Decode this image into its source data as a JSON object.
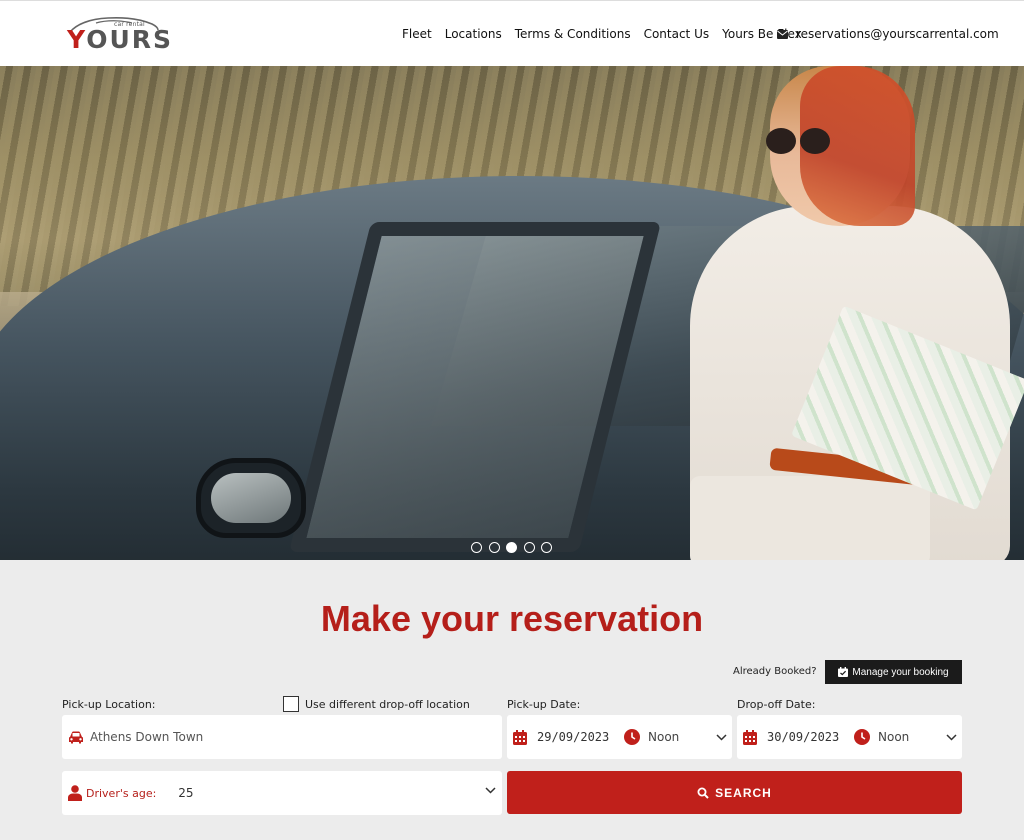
{
  "brand": {
    "logo_tagline": "car rental",
    "logo_letter": "Y",
    "logo_rest": "OURS"
  },
  "nav": {
    "items": [
      "Fleet",
      "Locations",
      "Terms & Conditions",
      "Contact Us",
      "Yours Be Flex"
    ],
    "email": "reservations@yourscarrental.com"
  },
  "hero": {
    "slide_count": 5,
    "active_slide": 3
  },
  "reservation": {
    "title": "Make your reservation",
    "already_booked": "Already Booked?",
    "manage_label": "Manage your booking",
    "pickup_location_label": "Pick-up Location:",
    "different_dropoff_label": "Use different drop-off location",
    "pickup_location_value": "Athens Down Town",
    "pickup_date_label": "Pick-up Date:",
    "pickup_date": "29/09/2023",
    "pickup_time": "Noon",
    "dropoff_date_label": "Drop-off Date:",
    "dropoff_date": "30/09/2023",
    "dropoff_time": "Noon",
    "drivers_age_label": "Driver's age:",
    "drivers_age": "25",
    "search_label": "SEARCH"
  },
  "colors": {
    "accent": "#c0201b",
    "dark": "#1b1b1b",
    "section_bg": "#ececec"
  }
}
